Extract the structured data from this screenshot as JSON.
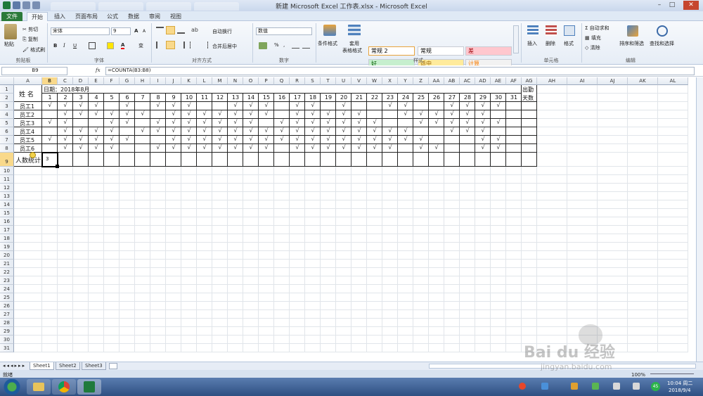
{
  "window": {
    "title": "新建 Microsoft Excel 工作表.xlsx - Microsoft Excel",
    "controls": {
      "minimize": "–",
      "maximize": "□",
      "close": "✕"
    }
  },
  "ribbon_tabs": [
    "文件",
    "开始",
    "插入",
    "页面布局",
    "公式",
    "数据",
    "审阅",
    "视图"
  ],
  "ribbon": {
    "clipboard": {
      "paste": "粘贴",
      "cut": "剪切",
      "copy": "复制",
      "format_painter": "格式刷",
      "group": "剪贴板"
    },
    "font": {
      "name": "宋体",
      "size": "9",
      "bold": "B",
      "italic": "I",
      "underline": "U",
      "grow": "A",
      "shrink": "A",
      "font_color_letter": "A",
      "wen": "变",
      "group": "字体"
    },
    "alignment": {
      "wrap": "自动换行",
      "merge": "合并后居中",
      "group": "对齐方式"
    },
    "number": {
      "format": "数值",
      "percent": "%",
      "comma": ",",
      "group": "数字"
    },
    "styles": {
      "conditional": "条件格式",
      "table": [
        "套用",
        "表格格式"
      ],
      "cells": [
        {
          "label": "常规 2",
          "bg": "#ffffff",
          "fg": "#000000"
        },
        {
          "label": "常规",
          "bg": "#ffffff",
          "fg": "#000000"
        },
        {
          "label": "差",
          "bg": "#ffc7ce",
          "fg": "#9c0006"
        },
        {
          "label": "好",
          "bg": "#c6efce",
          "fg": "#006100"
        },
        {
          "label": "适中",
          "bg": "#ffeb9c",
          "fg": "#9c6500"
        },
        {
          "label": "计算",
          "bg": "#f2f2f2",
          "fg": "#fa7d00"
        }
      ],
      "group": "样式"
    },
    "cells": {
      "insert": "插入",
      "delete": "删除",
      "format": "格式",
      "group": "单元格"
    },
    "editing": {
      "autosum": "自动求和",
      "fill": "填充",
      "clear": "清除",
      "sort": "排序和筛选",
      "find": "查找和选择",
      "sum_symbol": "Σ",
      "group": "编辑"
    }
  },
  "formula_bar": {
    "name_box": "B9",
    "fx": "fx",
    "formula": "=COUNTA(B3:B8)"
  },
  "columns": [
    "A",
    "B",
    "C",
    "D",
    "E",
    "F",
    "G",
    "H",
    "I",
    "J",
    "K",
    "L",
    "M",
    "N",
    "O",
    "P",
    "Q",
    "R",
    "S",
    "T",
    "U",
    "V",
    "W",
    "X",
    "Y",
    "Z",
    "AA",
    "AB",
    "AC",
    "AD",
    "AE",
    "AF",
    "AG",
    "AH",
    "AI",
    "AJ",
    "AK",
    "AL"
  ],
  "rows": [
    "1",
    "2",
    "3",
    "4",
    "5",
    "6",
    "7",
    "8",
    "9",
    "10",
    "11",
    "12",
    "13",
    "14",
    "15",
    "16",
    "17",
    "18",
    "19",
    "20",
    "21",
    "22",
    "23",
    "24",
    "25",
    "26",
    "27",
    "28",
    "29",
    "30",
    "31"
  ],
  "sheet": {
    "name_header": "姓  名",
    "date_header": "日期：2018年8月",
    "attendance_header": [
      "出勤",
      "天数"
    ],
    "days": [
      "1",
      "2",
      "3",
      "4",
      "5",
      "6",
      "7",
      "8",
      "9",
      "10",
      "11",
      "12",
      "13",
      "14",
      "15",
      "16",
      "17",
      "18",
      "19",
      "20",
      "21",
      "22",
      "23",
      "24",
      "25",
      "26",
      "27",
      "28",
      "29",
      "30",
      "31"
    ],
    "check": "√",
    "employees": [
      {
        "name": "员工1",
        "days": [
          1,
          2,
          3,
          4,
          6,
          8,
          9,
          10,
          13,
          14,
          15,
          17,
          18,
          20,
          23,
          24,
          27,
          28,
          29,
          30
        ]
      },
      {
        "name": "员工2",
        "days": [
          2,
          3,
          4,
          5,
          6,
          7,
          9,
          10,
          11,
          12,
          13,
          14,
          15,
          17,
          18,
          19,
          20,
          21,
          24,
          25,
          26,
          27,
          28,
          29
        ]
      },
      {
        "name": "员工3",
        "days": [
          1,
          2,
          5,
          6,
          8,
          9,
          10,
          11,
          12,
          13,
          14,
          16,
          17,
          18,
          19,
          20,
          21,
          22,
          25,
          26,
          27,
          28,
          29,
          30
        ]
      },
      {
        "name": "员工4",
        "days": [
          2,
          3,
          4,
          5,
          7,
          8,
          9,
          10,
          11,
          12,
          13,
          14,
          15,
          16,
          17,
          18,
          19,
          20,
          21,
          22,
          23,
          24,
          27,
          28,
          29
        ]
      },
      {
        "name": "员工5",
        "days": [
          1,
          2,
          3,
          4,
          5,
          6,
          9,
          10,
          11,
          12,
          13,
          14,
          15,
          16,
          17,
          18,
          19,
          20,
          21,
          22,
          23,
          24,
          25,
          29,
          30
        ]
      },
      {
        "name": "员工6",
        "days": [
          2,
          3,
          4,
          5,
          8,
          9,
          10,
          11,
          12,
          13,
          14,
          15,
          17,
          18,
          19,
          20,
          21,
          22,
          23,
          25,
          26,
          29,
          30
        ]
      }
    ],
    "summary_label": "人数统计",
    "summary_value": "3"
  },
  "sheet_tabs": [
    "Sheet1",
    "Sheet2",
    "Sheet3"
  ],
  "status": {
    "ready": "就绪",
    "zoom": "100%"
  },
  "taskbar": {
    "time": "10:04 周二",
    "date": "2018/9/4",
    "badge": "45"
  },
  "watermark": {
    "brand": "Bai du 经验",
    "url": "jingyan.baidu.com"
  },
  "colors": {
    "excel_green": "#2a7a3a",
    "selected_header": "#f9d98b",
    "ribbon_bg": "#e6edf6"
  }
}
